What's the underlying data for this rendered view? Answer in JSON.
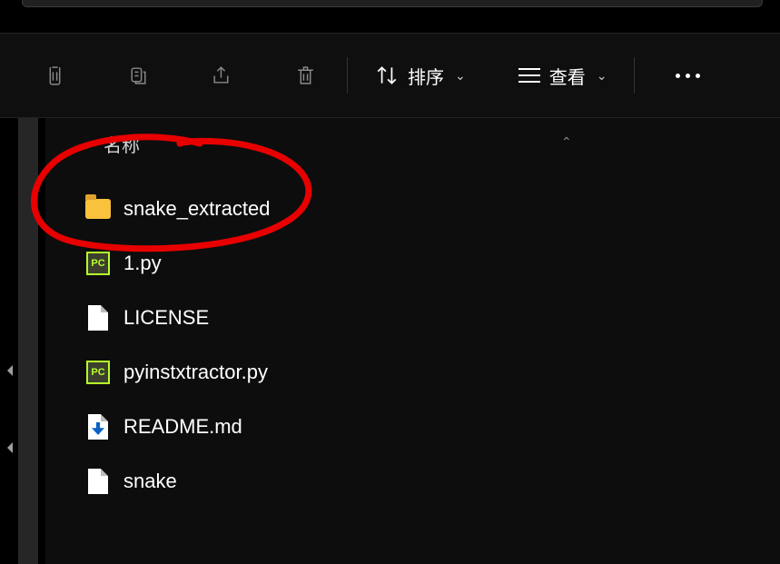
{
  "toolbar": {
    "sort_label": "排序",
    "view_label": "查看"
  },
  "columns": {
    "name": "名称"
  },
  "files": [
    {
      "name": "snake_extracted",
      "icon": "folder"
    },
    {
      "name": "1.py",
      "icon": "python"
    },
    {
      "name": "LICENSE",
      "icon": "file"
    },
    {
      "name": "pyinstxtractor.py",
      "icon": "python"
    },
    {
      "name": "README.md",
      "icon": "download"
    },
    {
      "name": "snake",
      "icon": "file"
    }
  ]
}
